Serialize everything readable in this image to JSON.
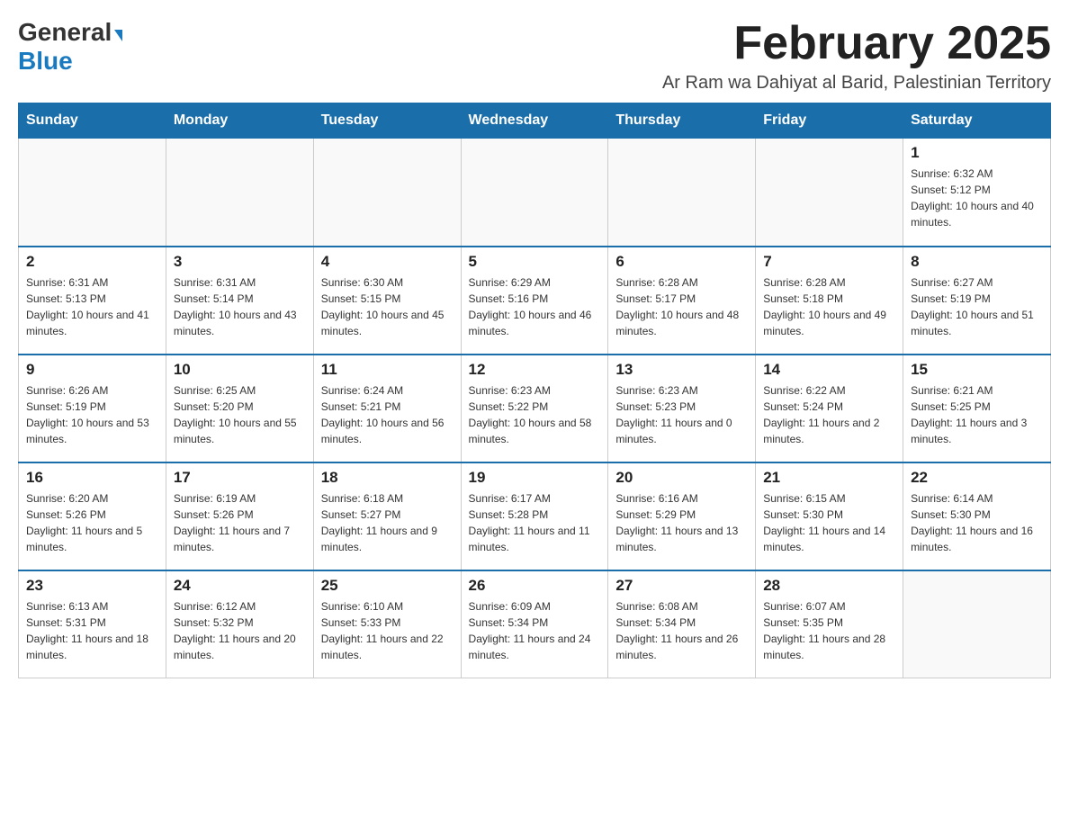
{
  "logo": {
    "general": "General",
    "blue": "Blue",
    "arrow": "▶"
  },
  "header": {
    "title": "February 2025",
    "subtitle": "Ar Ram wa Dahiyat al Barid, Palestinian Territory"
  },
  "weekdays": [
    "Sunday",
    "Monday",
    "Tuesday",
    "Wednesday",
    "Thursday",
    "Friday",
    "Saturday"
  ],
  "weeks": [
    [
      {
        "day": "",
        "sunrise": "",
        "sunset": "",
        "daylight": ""
      },
      {
        "day": "",
        "sunrise": "",
        "sunset": "",
        "daylight": ""
      },
      {
        "day": "",
        "sunrise": "",
        "sunset": "",
        "daylight": ""
      },
      {
        "day": "",
        "sunrise": "",
        "sunset": "",
        "daylight": ""
      },
      {
        "day": "",
        "sunrise": "",
        "sunset": "",
        "daylight": ""
      },
      {
        "day": "",
        "sunrise": "",
        "sunset": "",
        "daylight": ""
      },
      {
        "day": "1",
        "sunrise": "Sunrise: 6:32 AM",
        "sunset": "Sunset: 5:12 PM",
        "daylight": "Daylight: 10 hours and 40 minutes."
      }
    ],
    [
      {
        "day": "2",
        "sunrise": "Sunrise: 6:31 AM",
        "sunset": "Sunset: 5:13 PM",
        "daylight": "Daylight: 10 hours and 41 minutes."
      },
      {
        "day": "3",
        "sunrise": "Sunrise: 6:31 AM",
        "sunset": "Sunset: 5:14 PM",
        "daylight": "Daylight: 10 hours and 43 minutes."
      },
      {
        "day": "4",
        "sunrise": "Sunrise: 6:30 AM",
        "sunset": "Sunset: 5:15 PM",
        "daylight": "Daylight: 10 hours and 45 minutes."
      },
      {
        "day": "5",
        "sunrise": "Sunrise: 6:29 AM",
        "sunset": "Sunset: 5:16 PM",
        "daylight": "Daylight: 10 hours and 46 minutes."
      },
      {
        "day": "6",
        "sunrise": "Sunrise: 6:28 AM",
        "sunset": "Sunset: 5:17 PM",
        "daylight": "Daylight: 10 hours and 48 minutes."
      },
      {
        "day": "7",
        "sunrise": "Sunrise: 6:28 AM",
        "sunset": "Sunset: 5:18 PM",
        "daylight": "Daylight: 10 hours and 49 minutes."
      },
      {
        "day": "8",
        "sunrise": "Sunrise: 6:27 AM",
        "sunset": "Sunset: 5:19 PM",
        "daylight": "Daylight: 10 hours and 51 minutes."
      }
    ],
    [
      {
        "day": "9",
        "sunrise": "Sunrise: 6:26 AM",
        "sunset": "Sunset: 5:19 PM",
        "daylight": "Daylight: 10 hours and 53 minutes."
      },
      {
        "day": "10",
        "sunrise": "Sunrise: 6:25 AM",
        "sunset": "Sunset: 5:20 PM",
        "daylight": "Daylight: 10 hours and 55 minutes."
      },
      {
        "day": "11",
        "sunrise": "Sunrise: 6:24 AM",
        "sunset": "Sunset: 5:21 PM",
        "daylight": "Daylight: 10 hours and 56 minutes."
      },
      {
        "day": "12",
        "sunrise": "Sunrise: 6:23 AM",
        "sunset": "Sunset: 5:22 PM",
        "daylight": "Daylight: 10 hours and 58 minutes."
      },
      {
        "day": "13",
        "sunrise": "Sunrise: 6:23 AM",
        "sunset": "Sunset: 5:23 PM",
        "daylight": "Daylight: 11 hours and 0 minutes."
      },
      {
        "day": "14",
        "sunrise": "Sunrise: 6:22 AM",
        "sunset": "Sunset: 5:24 PM",
        "daylight": "Daylight: 11 hours and 2 minutes."
      },
      {
        "day": "15",
        "sunrise": "Sunrise: 6:21 AM",
        "sunset": "Sunset: 5:25 PM",
        "daylight": "Daylight: 11 hours and 3 minutes."
      }
    ],
    [
      {
        "day": "16",
        "sunrise": "Sunrise: 6:20 AM",
        "sunset": "Sunset: 5:26 PM",
        "daylight": "Daylight: 11 hours and 5 minutes."
      },
      {
        "day": "17",
        "sunrise": "Sunrise: 6:19 AM",
        "sunset": "Sunset: 5:26 PM",
        "daylight": "Daylight: 11 hours and 7 minutes."
      },
      {
        "day": "18",
        "sunrise": "Sunrise: 6:18 AM",
        "sunset": "Sunset: 5:27 PM",
        "daylight": "Daylight: 11 hours and 9 minutes."
      },
      {
        "day": "19",
        "sunrise": "Sunrise: 6:17 AM",
        "sunset": "Sunset: 5:28 PM",
        "daylight": "Daylight: 11 hours and 11 minutes."
      },
      {
        "day": "20",
        "sunrise": "Sunrise: 6:16 AM",
        "sunset": "Sunset: 5:29 PM",
        "daylight": "Daylight: 11 hours and 13 minutes."
      },
      {
        "day": "21",
        "sunrise": "Sunrise: 6:15 AM",
        "sunset": "Sunset: 5:30 PM",
        "daylight": "Daylight: 11 hours and 14 minutes."
      },
      {
        "day": "22",
        "sunrise": "Sunrise: 6:14 AM",
        "sunset": "Sunset: 5:30 PM",
        "daylight": "Daylight: 11 hours and 16 minutes."
      }
    ],
    [
      {
        "day": "23",
        "sunrise": "Sunrise: 6:13 AM",
        "sunset": "Sunset: 5:31 PM",
        "daylight": "Daylight: 11 hours and 18 minutes."
      },
      {
        "day": "24",
        "sunrise": "Sunrise: 6:12 AM",
        "sunset": "Sunset: 5:32 PM",
        "daylight": "Daylight: 11 hours and 20 minutes."
      },
      {
        "day": "25",
        "sunrise": "Sunrise: 6:10 AM",
        "sunset": "Sunset: 5:33 PM",
        "daylight": "Daylight: 11 hours and 22 minutes."
      },
      {
        "day": "26",
        "sunrise": "Sunrise: 6:09 AM",
        "sunset": "Sunset: 5:34 PM",
        "daylight": "Daylight: 11 hours and 24 minutes."
      },
      {
        "day": "27",
        "sunrise": "Sunrise: 6:08 AM",
        "sunset": "Sunset: 5:34 PM",
        "daylight": "Daylight: 11 hours and 26 minutes."
      },
      {
        "day": "28",
        "sunrise": "Sunrise: 6:07 AM",
        "sunset": "Sunset: 5:35 PM",
        "daylight": "Daylight: 11 hours and 28 minutes."
      },
      {
        "day": "",
        "sunrise": "",
        "sunset": "",
        "daylight": ""
      }
    ]
  ]
}
